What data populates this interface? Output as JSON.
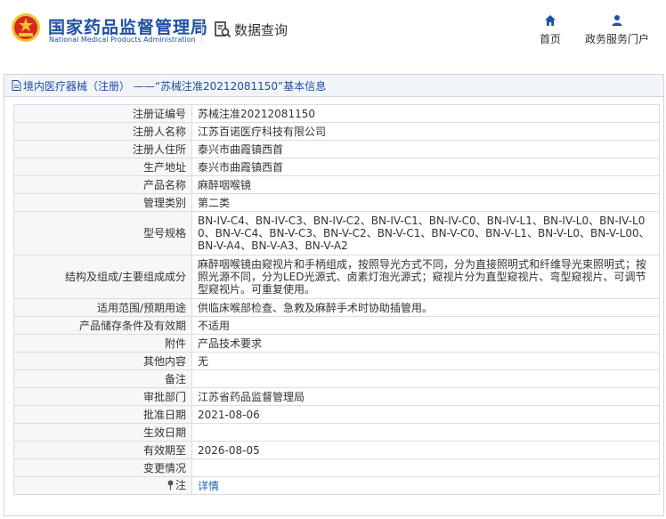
{
  "header": {
    "site_name_cn": "国家药品监督管理局",
    "site_name_en": "National Medical Products Administration",
    "data_query": "数据查询",
    "nav_home": "首页",
    "nav_portal": "政务服务门户"
  },
  "panel": {
    "title": "境内医疗器械（注册） ——“苏械注准20212081150”基本信息"
  },
  "colors": {
    "brand_blue": "#1e4fa3",
    "emblem_red": "#d42a1f",
    "emblem_gold": "#f2c230",
    "link": "#1e5fb8"
  },
  "rows": [
    {
      "label": "注册证编号",
      "value": "苏械注准20212081150"
    },
    {
      "label": "注册人名称",
      "value": "江苏百诺医疗科技有限公司"
    },
    {
      "label": "注册人住所",
      "value": "泰兴市曲霞镇西首"
    },
    {
      "label": "生产地址",
      "value": "泰兴市曲霞镇西首"
    },
    {
      "label": "产品名称",
      "value": "麻醉咽喉镜"
    },
    {
      "label": "管理类别",
      "value": "第二类"
    },
    {
      "label": "型号规格",
      "value": "BN-IV-C4、BN-IV-C3、BN-IV-C2、BN-IV-C1、BN-IV-C0、BN-IV-L1、BN-IV-L0、BN-IV-L00、BN-V-C4、BN-V-C3、BN-V-C2、BN-V-C1、BN-V-C0、BN-V-L1、BN-V-L0、BN-V-L00、BN-V-A4、BN-V-A3、BN-V-A2"
    },
    {
      "label": "结构及组成/主要组成成分",
      "value": "麻醉咽喉镜由窥视片和手柄组成，按照导光方式不同，分为直接照明式和纤维导光束照明式；按照光源不同，分为LED光源式、卤素灯泡光源式；窥视片分为直型窥视片、弯型窥视片、可调节型窥视片。可重复使用。"
    },
    {
      "label": "适用范围/预期用途",
      "value": "供临床喉部检查、急救及麻醉手术时协助插管用。"
    },
    {
      "label": "产品储存条件及有效期",
      "value": "不适用"
    },
    {
      "label": "附件",
      "value": "产品技术要求"
    },
    {
      "label": "其他内容",
      "value": "无"
    },
    {
      "label": "备注",
      "value": ""
    },
    {
      "label": "审批部门",
      "value": "江苏省药品监督管理局"
    },
    {
      "label": "批准日期",
      "value": "2021-08-06"
    },
    {
      "label": "生效日期",
      "value": ""
    },
    {
      "label": "有效期至",
      "value": "2026-08-05"
    },
    {
      "label": "变更情况",
      "value": ""
    },
    {
      "label": "注",
      "value": "详情"
    }
  ]
}
